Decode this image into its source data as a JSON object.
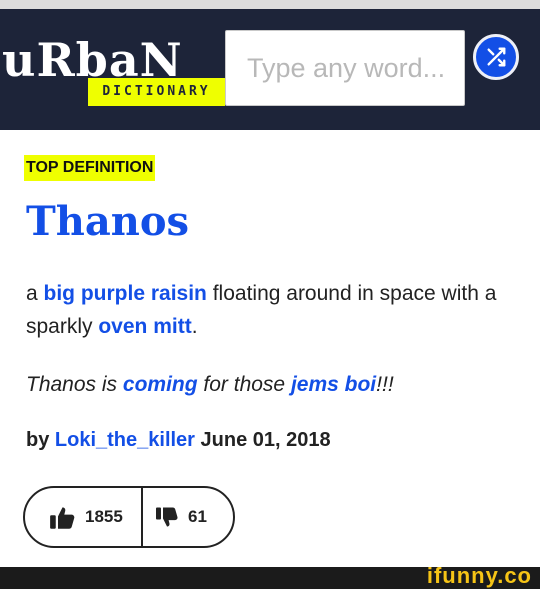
{
  "header": {
    "logo": {
      "word": "uRbaN",
      "subtitle": "DICTIONARY"
    },
    "search": {
      "placeholder": "Type any word..."
    },
    "shuffle_icon": "shuffle-icon"
  },
  "entry": {
    "badge": "TOP DEFINITION",
    "word": "Thanos",
    "meaning": {
      "part1": "a ",
      "link1": "big purple raisin",
      "part2": " floating around in space with a sparkly ",
      "link2": "oven mitt",
      "part3": "."
    },
    "example": {
      "part1": "Thanos is ",
      "link1": "coming",
      "part2": " for those ",
      "link2": "jems boi",
      "part3": "!!!"
    },
    "byline": {
      "prefix": "by ",
      "author": "Loki_the_killer",
      "date": " June 01, 2018"
    },
    "votes": {
      "up_icon": "thumbs-up-icon",
      "up": "1855",
      "down_icon": "thumbs-down-icon",
      "down": "61"
    }
  },
  "footer": {
    "watermark": "ifunny.co"
  },
  "colors": {
    "header_bg": "#1d2439",
    "brand_yellow": "#efff00",
    "link_blue": "#134fe6",
    "watermark": "#f6c416"
  }
}
